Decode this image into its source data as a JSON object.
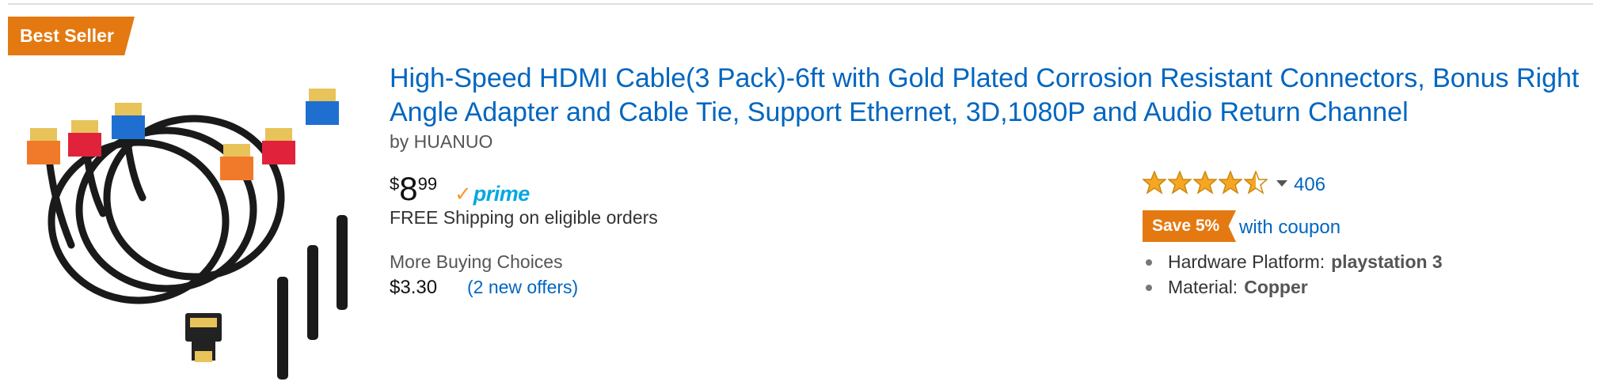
{
  "badge": {
    "label": "Best Seller"
  },
  "product": {
    "image_alt": "product-image",
    "title": "High-Speed HDMI Cable(3 Pack)-6ft with Gold Plated Corrosion Resistant Connectors, Bonus Right Angle Adapter and Cable Tie, Support Ethernet, 3D,1080P and Audio Return Channel",
    "byline": "by HUANUO"
  },
  "price": {
    "currency": "$",
    "whole": "8",
    "fraction": "99"
  },
  "prime": {
    "label": "prime",
    "icon": "prime-check-icon"
  },
  "shipping": {
    "text": "FREE Shipping on eligible orders"
  },
  "more_buying_choices": {
    "label": "More Buying Choices",
    "price": "$3.30",
    "offers": "(2 new offers)"
  },
  "rating": {
    "stars": 4.5,
    "max": 5,
    "count": "406"
  },
  "coupon": {
    "badge": "Save 5%",
    "text": "with coupon"
  },
  "attributes": [
    {
      "name": "Hardware Platform:",
      "value": "playstation 3"
    },
    {
      "name": "Material:",
      "value": "Copper"
    }
  ],
  "colors": {
    "link": "#0066c0",
    "badge": "#e47911",
    "prime": "#00a8e1",
    "star": "#f6a623"
  }
}
